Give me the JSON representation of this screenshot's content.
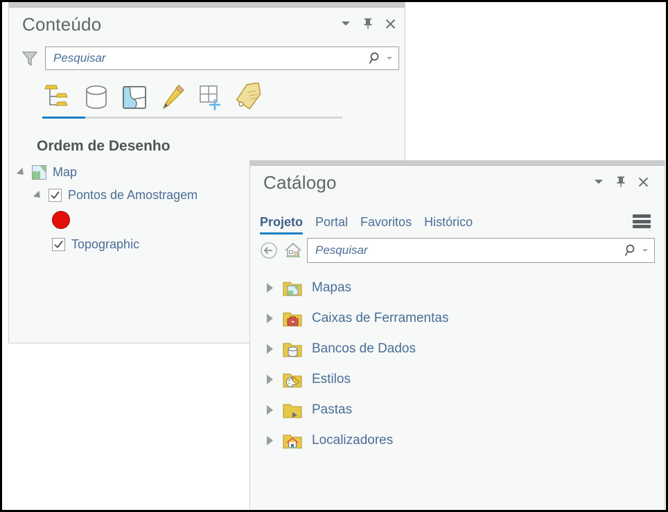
{
  "contents_panel": {
    "title": "Conteúdo",
    "title_buttons": [
      {
        "name": "panel-menu-caret",
        "label": "▾"
      },
      {
        "name": "pin-icon",
        "label": "Fixar"
      },
      {
        "name": "close-icon",
        "label": "Fechar"
      }
    ],
    "search": {
      "placeholder": "Pesquisar",
      "value": "",
      "filter_icon": "funnel-icon",
      "search_icon": "magnifier-icon",
      "dropdown_icon": "caret-down-icon"
    },
    "toolbar": {
      "active_index": 0,
      "items": [
        {
          "name": "list-by-drawing-order-icon",
          "label": "Listar por Ordem de Desenho"
        },
        {
          "name": "list-by-data-source-icon",
          "label": "Listar por Fonte de Dados"
        },
        {
          "name": "list-by-selection-icon",
          "label": "Listar por Seleção"
        },
        {
          "name": "list-by-editing-icon",
          "label": "Listar por Edição"
        },
        {
          "name": "list-by-snapping-icon",
          "label": "Listar por Snap"
        },
        {
          "name": "list-by-labeling-icon",
          "label": "Listar por Rotulagem"
        }
      ]
    },
    "toc_header": "Ordem de Desenho",
    "toc": [
      {
        "name": "map",
        "label": "Map",
        "icon": "map-thumbnail-icon",
        "expanded": true,
        "indent": 0,
        "type": "map"
      },
      {
        "name": "pontos-de-amostragem",
        "label": "Pontos de Amostragem",
        "checked": true,
        "expanded": true,
        "indent": 1,
        "type": "layer"
      },
      {
        "name": "point-symbol",
        "label": "",
        "indent": 2,
        "type": "symbol",
        "color": "#e11008"
      },
      {
        "name": "topographic",
        "label": "Topographic",
        "checked": true,
        "indent": 1,
        "type": "basemap"
      }
    ]
  },
  "catalog_panel": {
    "title": "Catálogo",
    "title_buttons": [
      {
        "name": "panel-menu-caret",
        "label": "▾"
      },
      {
        "name": "pin-icon",
        "label": "Fixar"
      },
      {
        "name": "close-icon",
        "label": "Fechar"
      }
    ],
    "tabs": [
      {
        "label": "Projeto",
        "active": true
      },
      {
        "label": "Portal",
        "active": false
      },
      {
        "label": "Favoritos",
        "active": false
      },
      {
        "label": "Histórico",
        "active": false
      }
    ],
    "menu_icon": "hamburger-menu-icon",
    "nav": {
      "back_icon": "back-arrow-icon",
      "home_icon": "home-icon"
    },
    "search": {
      "placeholder": "Pesquisar",
      "value": "",
      "search_icon": "magnifier-icon",
      "dropdown_icon": "caret-down-icon"
    },
    "tree": [
      {
        "label": "Mapas",
        "icon": "folder-maps-icon"
      },
      {
        "label": "Caixas de Ferramentas",
        "icon": "folder-toolboxes-icon"
      },
      {
        "label": "Bancos de Dados",
        "icon": "folder-databases-icon"
      },
      {
        "label": "Estilos",
        "icon": "folder-styles-icon"
      },
      {
        "label": "Pastas",
        "icon": "folder-folders-icon"
      },
      {
        "label": "Localizadores",
        "icon": "folder-locators-icon"
      }
    ]
  },
  "colors": {
    "accent": "#1b7fc4",
    "link_text": "#4a6e96",
    "panel_bg": "#f7f8f8",
    "symbol_red": "#e11008",
    "folder_yellow": "#e8c84a"
  }
}
